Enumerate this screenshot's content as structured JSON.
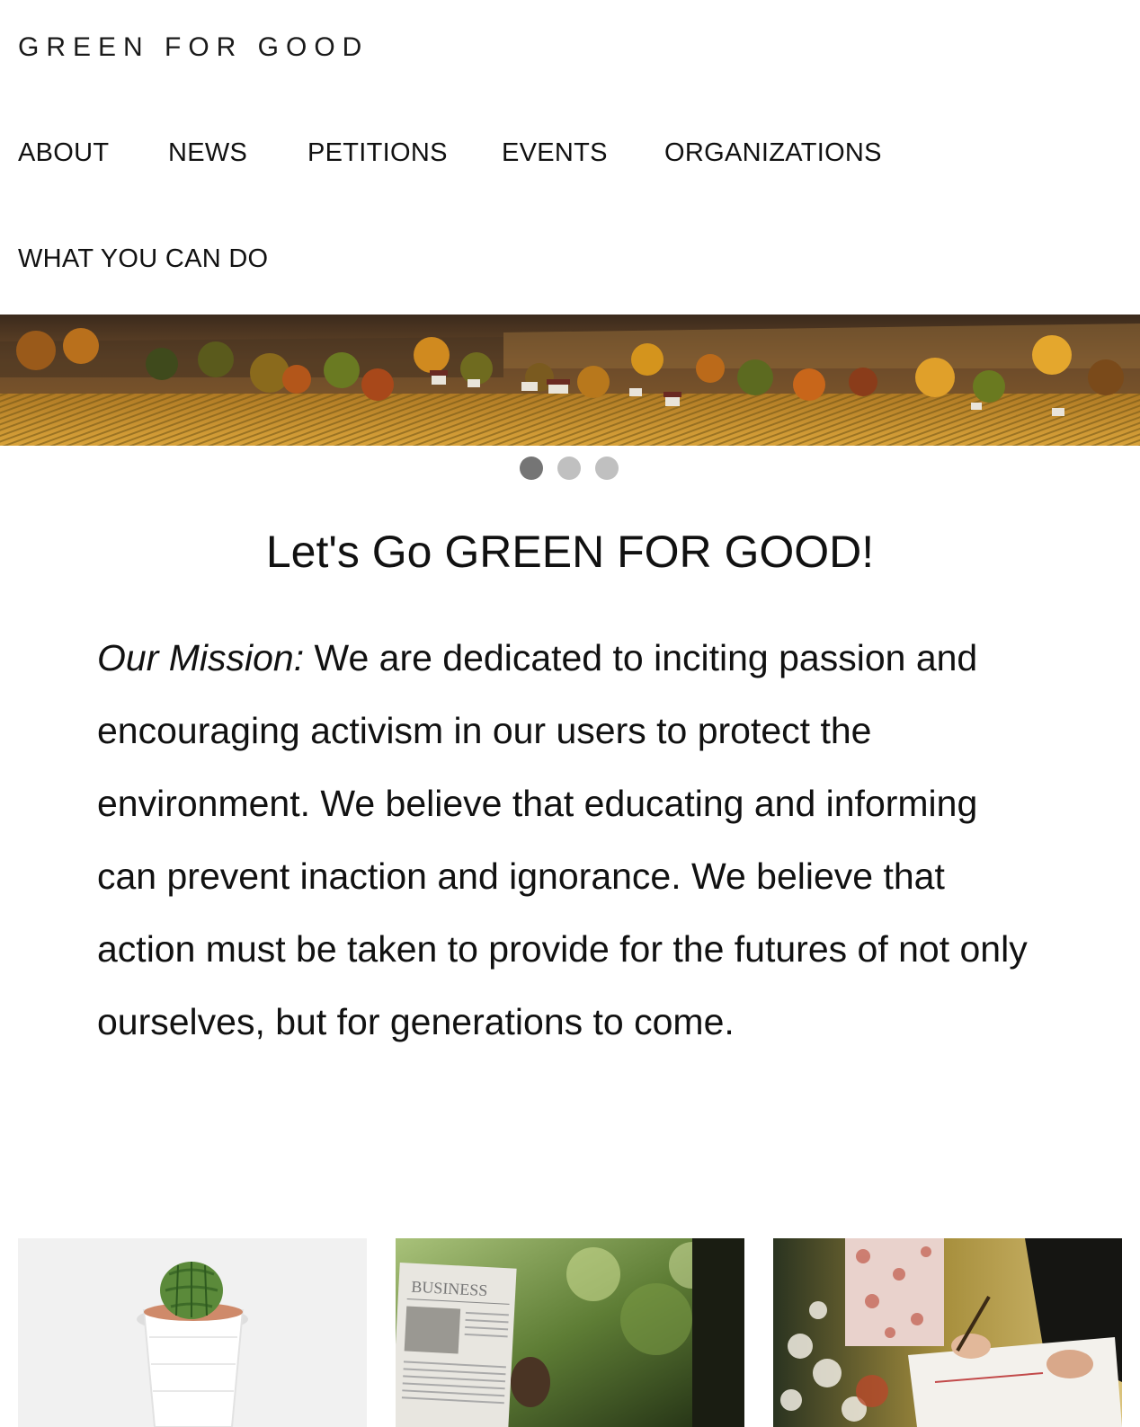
{
  "site": {
    "brand": "GREEN FOR GOOD"
  },
  "nav": {
    "items": [
      {
        "label": "ABOUT"
      },
      {
        "label": "NEWS"
      },
      {
        "label": "PETITIONS"
      },
      {
        "label": "EVENTS"
      },
      {
        "label": "ORGANIZATIONS"
      },
      {
        "label": "WHAT YOU CAN DO"
      }
    ]
  },
  "hero": {
    "slide_count": 3,
    "active_slide": 1
  },
  "main": {
    "headline": "Let's Go GREEN FOR GOOD!",
    "mission_label": "Our Mission:",
    "mission_text": " We are dedicated to inciting passion and encouraging activism in our users to protect the environment. We believe that educating and informing can prevent inaction and ignorance. We believe that action must be taken to provide for the futures of not only ourselves, but for generations to come."
  },
  "cards": {
    "newspaper_masthead": "BUSINESS"
  },
  "colors": {
    "text": "#111111",
    "dot_active": "#757575",
    "dot_inactive": "#c0c0c0",
    "hero_sky": "#3b2a1c",
    "hero_field": "#c98e2a"
  }
}
